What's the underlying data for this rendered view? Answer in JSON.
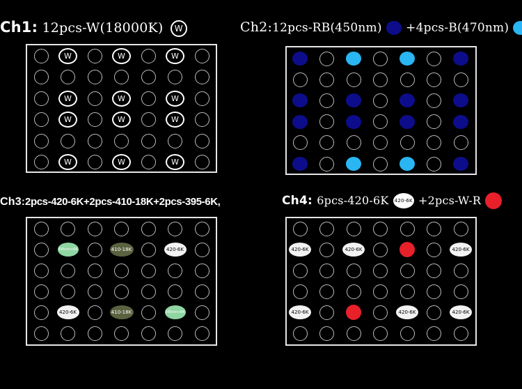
{
  "colors": {
    "background": "#000000",
    "border": "#e6e6e6",
    "empty_ring": "#bdbdbd",
    "white_led": "#ffffff",
    "royal_blue": "#0d0d8c",
    "blue": "#29b6f2",
    "red": "#e8202a",
    "uv_395": "#8fd6a2",
    "violet_410": "#5a6240",
    "w420": "#f2f2f2"
  },
  "ch1": {
    "label": "Ch1",
    "sep": ":",
    "desc": "12pcs-W(18000K)",
    "icon_text": "W",
    "grid": [
      [
        "o",
        "W",
        "o",
        "W",
        "o",
        "W",
        "o"
      ],
      [
        "o",
        "o",
        "o",
        "o",
        "o",
        "o",
        "o"
      ],
      [
        "o",
        "W",
        "o",
        "W",
        "o",
        "W",
        "o"
      ],
      [
        "o",
        "W",
        "o",
        "W",
        "o",
        "W",
        "o"
      ],
      [
        "o",
        "o",
        "o",
        "o",
        "o",
        "o",
        "o"
      ],
      [
        "o",
        "W",
        "o",
        "W",
        "o",
        "W",
        "o"
      ]
    ],
    "led_text": "W"
  },
  "ch2": {
    "label": "Ch2",
    "sep": ":",
    "desc1": "12pcs-RB(450nm)",
    "desc2": "+4pcs-B(470nm)",
    "grid": [
      [
        "RB",
        "o",
        "B",
        "o",
        "B",
        "o",
        "RB"
      ],
      [
        "o",
        "o",
        "o",
        "o",
        "o",
        "o",
        "o"
      ],
      [
        "RB",
        "o",
        "RB",
        "o",
        "RB",
        "o",
        "RB"
      ],
      [
        "RB",
        "o",
        "RB",
        "o",
        "RB",
        "o",
        "RB"
      ],
      [
        "o",
        "o",
        "o",
        "o",
        "o",
        "o",
        "o"
      ],
      [
        "RB",
        "o",
        "B",
        "o",
        "B",
        "o",
        "RB"
      ]
    ]
  },
  "ch3": {
    "label": "Ch3",
    "sep": ":",
    "desc": "2pcs-420-6K+2pcs-410-18K+2pcs-395-6K,",
    "grid": [
      [
        "o",
        "o",
        "o",
        "o",
        "o",
        "o",
        "o"
      ],
      [
        "o",
        "UV",
        "o",
        "V410",
        "o",
        "W420",
        "o"
      ],
      [
        "o",
        "o",
        "o",
        "o",
        "o",
        "o",
        "o"
      ],
      [
        "o",
        "o",
        "o",
        "o",
        "o",
        "o",
        "o"
      ],
      [
        "o",
        "W420",
        "o",
        "V410",
        "o",
        "UV",
        "o"
      ],
      [
        "o",
        "o",
        "o",
        "o",
        "o",
        "o",
        "o"
      ]
    ],
    "uv_text": "395nm+6K",
    "v410_text": "410-18K",
    "w420_text": "420-6K"
  },
  "ch4": {
    "label": "Ch4",
    "sep": ":",
    "desc1": "6pcs-420-6K",
    "icon_text": "420-6K",
    "desc2": "+2pcs-W-R",
    "grid": [
      [
        "o",
        "o",
        "o",
        "o",
        "o",
        "o",
        "o"
      ],
      [
        "W420",
        "o",
        "W420",
        "o",
        "R",
        "o",
        "W420"
      ],
      [
        "o",
        "o",
        "o",
        "o",
        "o",
        "o",
        "o"
      ],
      [
        "o",
        "o",
        "o",
        "o",
        "o",
        "o",
        "o"
      ],
      [
        "W420",
        "o",
        "R",
        "o",
        "W420",
        "o",
        "W420"
      ],
      [
        "o",
        "o",
        "o",
        "o",
        "o",
        "o",
        "o"
      ]
    ],
    "w420_text": "420-6K"
  }
}
